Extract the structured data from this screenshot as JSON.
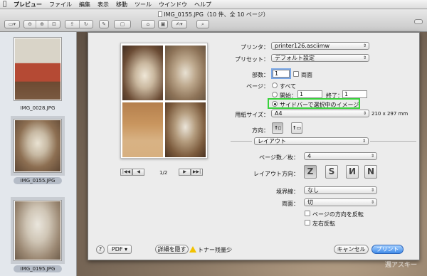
{
  "menubar": {
    "apple": "",
    "items": [
      "プレビュー",
      "ファイル",
      "編集",
      "表示",
      "移動",
      "ツール",
      "ウインドウ",
      "ヘルプ"
    ]
  },
  "window": {
    "title": "IMG_0155.JPG（10 件、全 10 ページ）"
  },
  "sidebar": {
    "thumbs": [
      {
        "label": "IMG_0028.JPG"
      },
      {
        "label": "IMG_0155.JPG"
      },
      {
        "label": "IMG_0195.JPG"
      }
    ]
  },
  "preview": {
    "page_indicator": "1/2"
  },
  "print": {
    "printer_label": "プリンタ：",
    "printer_value": "printer126.asciimw",
    "preset_label": "プリセット：",
    "preset_value": "デフォルト設定",
    "copies_label": "部数：",
    "copies_value": "1",
    "duplex_label": "両面",
    "pages_label": "ページ：",
    "all_label": "すべて",
    "from_label": "開始：",
    "from_value": "1",
    "to_label": "終了：",
    "to_value": "1",
    "sidebar_selection_label": "サイドバーで選択中のイメージ",
    "paper_size_label": "用紙サイズ：",
    "paper_size_value": "A4",
    "paper_dims": "210 x 297 mm",
    "orientation_label": "方向：",
    "section_value": "レイアウト",
    "pages_per_sheet_label": "ページ数／枚：",
    "pages_per_sheet_value": "4",
    "layout_direction_label": "レイアウト方向：",
    "border_label": "境界線：",
    "border_value": "なし",
    "two_sided_label": "両面：",
    "two_sided_value": "切",
    "reverse_orientation_label": "ページの方向を反転",
    "flip_horizontal_label": "左右反転",
    "help_label": "?",
    "pdf_label": "PDF",
    "hide_details_label": "詳細を隠す",
    "toner_label": "トナー残量少",
    "cancel_label": "キャンセル",
    "print_label": "プリント"
  },
  "watermark": "週アスキー",
  "colors": {
    "highlight_green": "#39d23c",
    "default_button": "#3f8ae8"
  }
}
